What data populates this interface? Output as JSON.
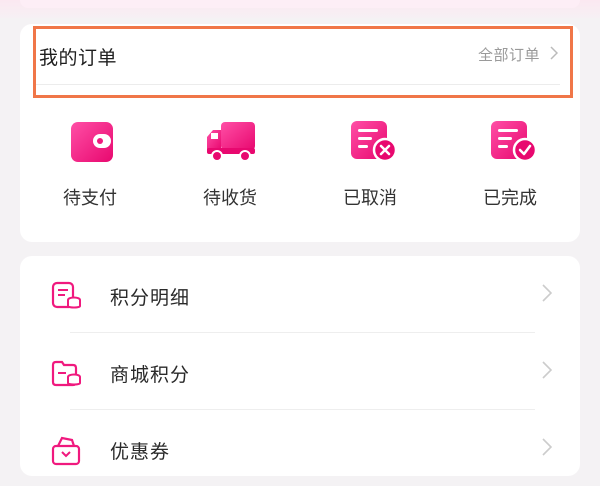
{
  "orders": {
    "title": "我的订单",
    "all_orders": "全部订单",
    "items": [
      {
        "label": "待支付",
        "icon": "wallet-icon"
      },
      {
        "label": "待收货",
        "icon": "truck-icon"
      },
      {
        "label": "已取消",
        "icon": "cancelled-order-icon"
      },
      {
        "label": "已完成",
        "icon": "completed-order-icon"
      }
    ]
  },
  "menu": {
    "items": [
      {
        "label": "积分明细",
        "icon": "points-detail-icon"
      },
      {
        "label": "商城积分",
        "icon": "mall-points-icon"
      },
      {
        "label": "优惠券",
        "icon": "coupon-icon"
      }
    ]
  },
  "colors": {
    "accent": "#f0197e",
    "highlight": "#f07648",
    "background": "#f4f2f4"
  }
}
